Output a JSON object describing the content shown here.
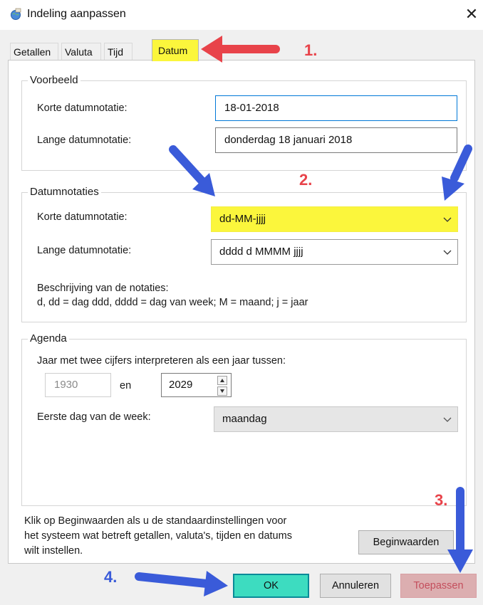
{
  "window": {
    "title": "Indeling aanpassen"
  },
  "tabs": [
    {
      "label": "Getallen"
    },
    {
      "label": "Valuta"
    },
    {
      "label": "Tijd"
    },
    {
      "label": "Datum"
    }
  ],
  "voorbeeld": {
    "title": "Voorbeeld",
    "short_label": "Korte datumnotatie:",
    "short_value": "18-01-2018",
    "long_label": "Lange datumnotatie:",
    "long_value": "donderdag 18 januari 2018"
  },
  "datumnotaties": {
    "title": "Datumnotaties",
    "short_label": "Korte datumnotatie:",
    "short_value": "dd-MM-jjjj",
    "long_label": "Lange datumnotatie:",
    "long_value": "dddd d MMMM jjjj",
    "desc_title": "Beschrijving van de notaties:",
    "desc_text": "d, dd = dag  ddd, dddd = dag van week;  M = maand;  j = jaar"
  },
  "agenda": {
    "title": "Agenda",
    "interpret_label": "Jaar met twee cijfers interpreteren als een jaar tussen:",
    "year_from": "1930",
    "en_label": "en",
    "year_to": "2029",
    "first_day_label": "Eerste dag van de week:",
    "first_day_value": "maandag"
  },
  "note": {
    "line1": "Klik op Beginwaarden als u de standaardinstellingen voor",
    "line2": "het systeem wat betreft getallen, valuta's, tijden en datums",
    "line3": "wilt instellen."
  },
  "buttons": {
    "reset": "Beginwaarden",
    "ok": "OK",
    "cancel": "Annuleren",
    "apply": "Toepassen"
  },
  "annotations": {
    "step1": "1.",
    "step2": "2.",
    "step3": "3.",
    "step4": "4.",
    "red_color": "#e8434a",
    "blue_color": "#3a5bd9",
    "highlight_color": "#fbf63c"
  }
}
